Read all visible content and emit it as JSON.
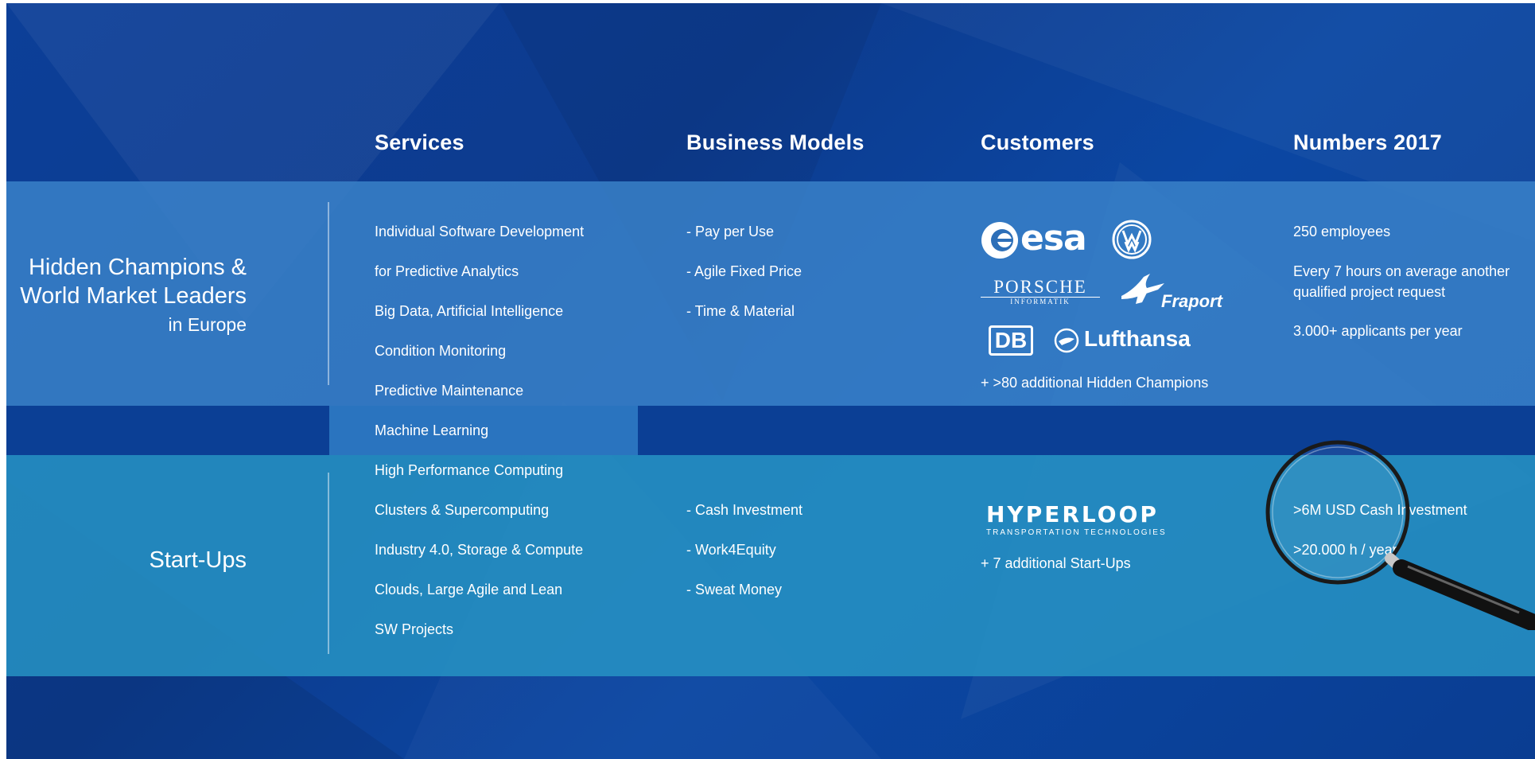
{
  "headers": {
    "services": "Services",
    "business_models": "Business Models",
    "customers": "Customers",
    "numbers": "Numbers 2017"
  },
  "rows": {
    "hidden_champions": {
      "line1": "Hidden Champions &",
      "line2": "World Market Leaders",
      "line3": "in Europe"
    },
    "startups": {
      "label": "Start-Ups"
    }
  },
  "services": [
    "Individual Software Development",
    "for Predictive Analytics",
    "Big Data, Artificial Intelligence",
    "Condition Monitoring",
    "Predictive Maintenance",
    "Machine Learning",
    "High Performance Computing",
    "Clusters & Supercomputing",
    "Industry 4.0, Storage & Compute",
    "Clouds, Large Agile and Lean",
    "SW Projects"
  ],
  "business_models": {
    "hidden_champions": [
      "- Pay per Use",
      "- Agile Fixed Price",
      "- Time & Material"
    ],
    "startups": [
      "- Cash Investment",
      "- Work4Equity",
      "- Sweat Money"
    ]
  },
  "customers": {
    "logos": {
      "esa": "esa",
      "porsche": "PORSCHE",
      "porsche_sub": "INFORMATIK",
      "fraport": "Fraport",
      "db": "DB",
      "lufthansa": "Lufthansa",
      "hyperloop": "HYPERLOOP",
      "hyperloop_sub": "TRANSPORTATION TECHNOLOGIES"
    },
    "hidden_champions_note": "+ >80 additional Hidden Champions",
    "startups_note": "+ 7 additional Start-Ups"
  },
  "numbers": {
    "hidden_champions": [
      "250 employees",
      "Every 7 hours on average another",
      "qualified project request",
      "3.000+ applicants per year"
    ],
    "startups": [
      ">6M USD Cash Investment",
      ">20.000 h / year"
    ]
  },
  "colors": {
    "background": "#0c3f98",
    "band_top": "#3b84cb",
    "band_bottom": "#2693c4",
    "text": "#ffffff"
  },
  "icons": [
    "magnifying-glass-icon",
    "vw-logo-icon",
    "fraport-plane-icon",
    "lufthansa-crane-icon",
    "esa-logo-icon"
  ]
}
